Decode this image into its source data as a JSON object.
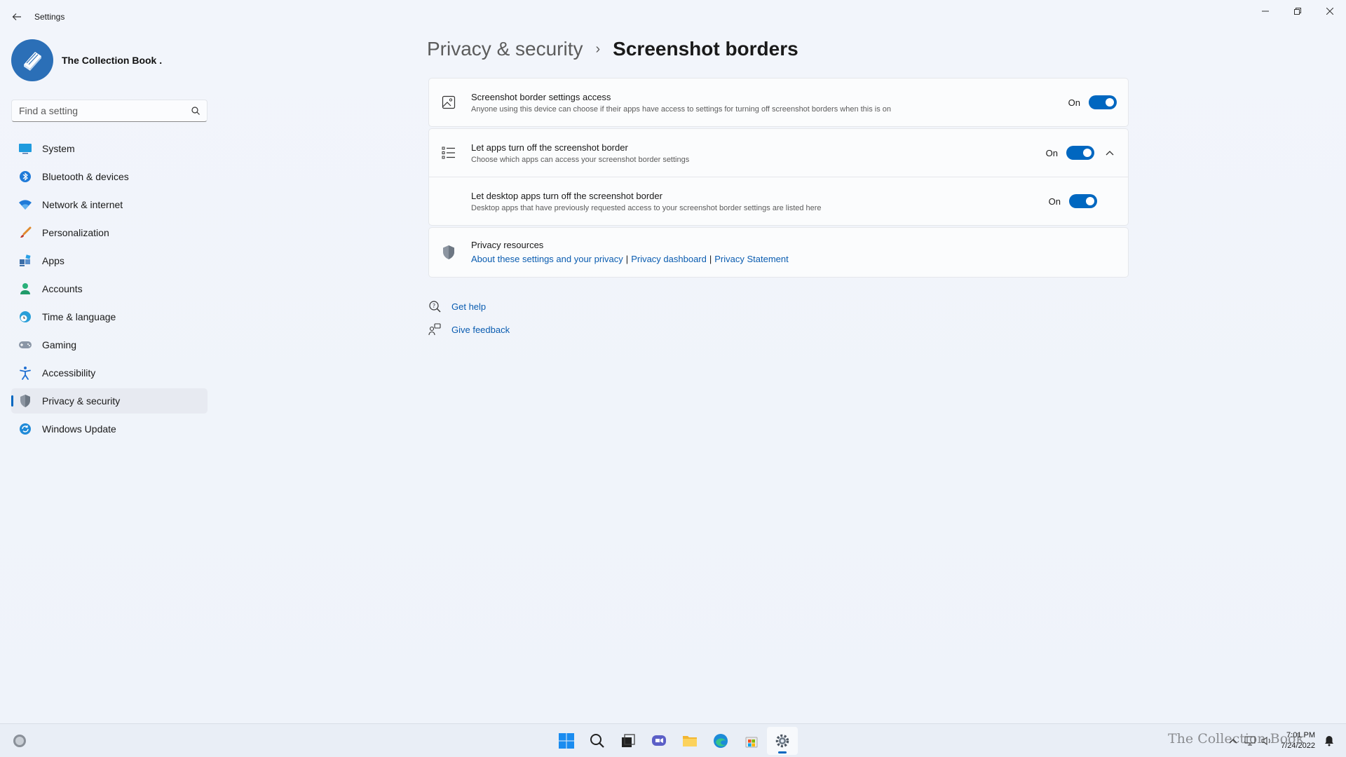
{
  "window": {
    "title": "Settings"
  },
  "profile": {
    "name": "The Collection Book ."
  },
  "search": {
    "placeholder": "Find a setting"
  },
  "sidebar": {
    "items": [
      {
        "label": "System",
        "icon": "system-icon"
      },
      {
        "label": "Bluetooth & devices",
        "icon": "bluetooth-icon"
      },
      {
        "label": "Network & internet",
        "icon": "wifi-icon"
      },
      {
        "label": "Personalization",
        "icon": "brush-icon"
      },
      {
        "label": "Apps",
        "icon": "apps-icon"
      },
      {
        "label": "Accounts",
        "icon": "accounts-icon"
      },
      {
        "label": "Time & language",
        "icon": "globe-clock-icon"
      },
      {
        "label": "Gaming",
        "icon": "gamepad-icon"
      },
      {
        "label": "Accessibility",
        "icon": "accessibility-icon"
      },
      {
        "label": "Privacy & security",
        "icon": "shield-icon",
        "active": true
      },
      {
        "label": "Windows Update",
        "icon": "update-icon"
      }
    ]
  },
  "breadcrumb": {
    "parent": "Privacy & security",
    "separator": "›",
    "current": "Screenshot borders"
  },
  "settings": {
    "access": {
      "title": "Screenshot border settings access",
      "description": "Anyone using this device can choose if their apps have access to settings for turning off screenshot borders when this is on",
      "state": "On"
    },
    "apps": {
      "title": "Let apps turn off the screenshot border",
      "description": "Choose which apps can access your screenshot border settings",
      "state": "On"
    },
    "desktop_apps": {
      "title": "Let desktop apps turn off the screenshot border",
      "description": "Desktop apps that have previously requested access to your screenshot border settings are listed here",
      "state": "On"
    }
  },
  "privacy_resources": {
    "title": "Privacy resources",
    "links": [
      "About these settings and your privacy",
      "Privacy dashboard",
      "Privacy Statement"
    ],
    "separator": "|"
  },
  "help": {
    "get_help": "Get help",
    "give_feedback": "Give feedback"
  },
  "taskbar": {
    "time": "7:01 PM",
    "date": "7/24/2022",
    "watermark": "The Collection Book"
  },
  "colors": {
    "accent": "#0067c0",
    "link": "#0a5cb0",
    "background": "#f3f6fc"
  }
}
